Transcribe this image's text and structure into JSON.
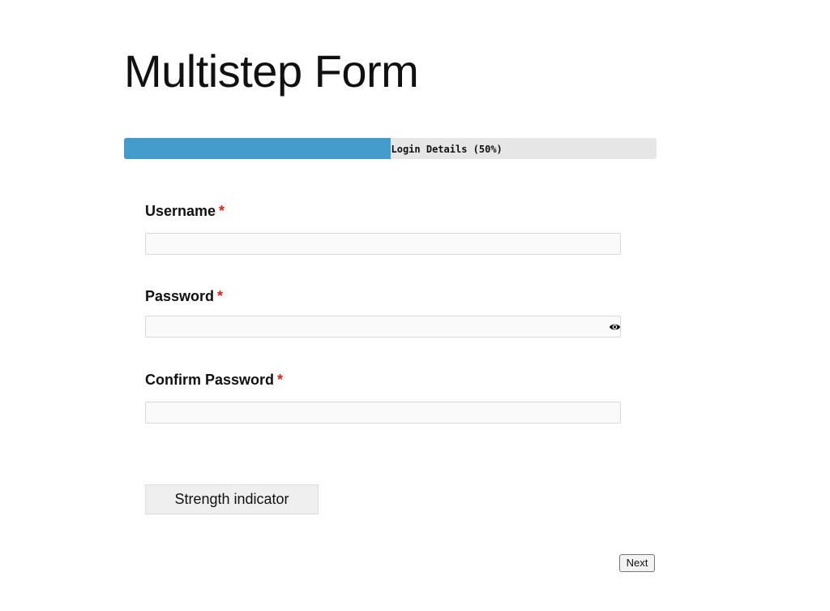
{
  "page": {
    "title": "Multistep Form"
  },
  "progress": {
    "label": "Login Details (50%)",
    "value_percent": 50,
    "fill_color": "#449ccd",
    "track_color": "#e6e6e6"
  },
  "form": {
    "required_marker": "*",
    "required_color": "#d0251b",
    "fields": {
      "username": {
        "label": "Username",
        "value": "",
        "placeholder": ""
      },
      "password": {
        "label": "Password",
        "value": "",
        "placeholder": "",
        "toggle_icon": "eye-icon"
      },
      "confirm_password": {
        "label": "Confirm Password",
        "value": "",
        "placeholder": ""
      }
    }
  },
  "buttons": {
    "strength_label": "Strength indicator",
    "next_label": "Next"
  }
}
